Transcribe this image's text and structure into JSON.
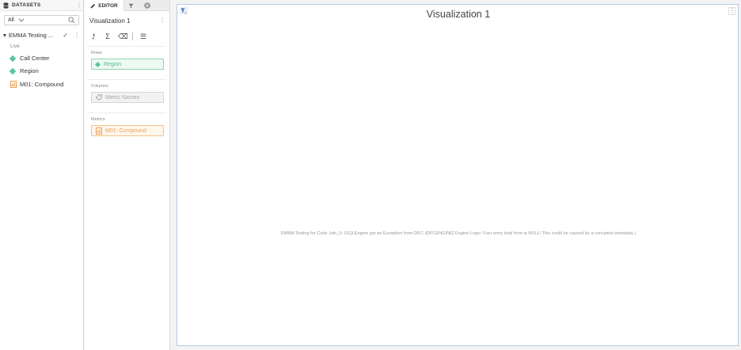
{
  "datasets": {
    "title": "DATASETS",
    "filter_value": "All",
    "dataset_name": "EMMA Testing ...",
    "status": "Live",
    "items": [
      {
        "label": "Call Center",
        "type": "attribute"
      },
      {
        "label": "Region",
        "type": "attribute"
      },
      {
        "label": "M01: Compound",
        "type": "metric"
      }
    ]
  },
  "editor": {
    "tabs": {
      "editor_label": "EDITOR"
    },
    "viz_name": "Visualization 1",
    "zones": {
      "rows": {
        "label": "Rows",
        "item": "Region"
      },
      "columns": {
        "label": "Columns",
        "item": "Metric Names"
      },
      "metrics": {
        "label": "Metrics",
        "item": "M01: Compound"
      }
    }
  },
  "canvas": {
    "title": "Visualization 1",
    "error": "EMMA Testing for Cube Join_0: (SQLEngine got an Exception from DFC: [DFCENGINE] Engine Logic: Fact entry total form is NULL! This could be caused by a corrupted metadata.)"
  },
  "colors": {
    "attribute": "#5bc59a",
    "metric": "#e9a25a",
    "canvas_border": "#b9cbe6"
  }
}
